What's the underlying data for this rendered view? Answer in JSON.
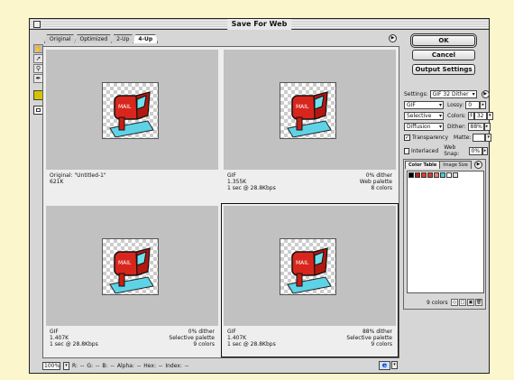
{
  "window": {
    "title": "Save For Web"
  },
  "tabs": [
    "Original",
    "Optimized",
    "2-Up",
    "4-Up"
  ],
  "active_tab": "4-Up",
  "panes": [
    {
      "lines_left": [
        "Original: \"Untitled-1\"",
        "621K"
      ],
      "lines_right": []
    },
    {
      "lines_left": [
        "GIF",
        "1.355K",
        "1 sec @ 28.8Kbps"
      ],
      "lines_right": [
        "0% dither",
        "Web palette",
        "8 colors"
      ]
    },
    {
      "lines_left": [
        "GIF",
        "1.407K",
        "1 sec @ 28.8Kbps"
      ],
      "lines_right": [
        "0% dither",
        "Selective palette",
        "9 colors"
      ]
    },
    {
      "lines_left": [
        "GIF",
        "1.407K",
        "1 sec @ 28.8Kbps"
      ],
      "lines_right": [
        "88% dither",
        "Selective palette",
        "9 colors"
      ]
    }
  ],
  "buttons": {
    "ok": "OK",
    "cancel": "Cancel",
    "output": "Output Settings"
  },
  "settings": {
    "label": "Settings:",
    "preset": "GIF 32 Dither",
    "format": "GIF",
    "lossy_label": "Lossy:",
    "lossy": "0",
    "reduction": "Selective",
    "colors_label": "Colors:",
    "colors": "32",
    "dither_algo": "Diffusion",
    "dither_label": "Dither:",
    "dither": "88%",
    "transparency": "Transparency",
    "matte_label": "Matte:",
    "interlaced": "Interlaced",
    "websnap_label": "Web Snap:",
    "websnap": "0%"
  },
  "panel": {
    "tab_color": "Color Table",
    "tab_size": "Image Size",
    "color_count": "9 colors",
    "swatches": [
      "#000000",
      "#c0201a",
      "#e03a2a",
      "#d04030",
      "#f08070",
      "#40d0e0",
      "#ffffff",
      "#e0e0e0"
    ]
  },
  "status": {
    "zoom": "100%",
    "r": "R:",
    "r_val": "--",
    "g": "G:",
    "g_val": "--",
    "b": "B:",
    "b_val": "--",
    "alpha": "Alpha:",
    "alpha_val": "--",
    "hex": "Hex:",
    "hex_val": "--",
    "index": "Index:",
    "index_val": "--"
  }
}
